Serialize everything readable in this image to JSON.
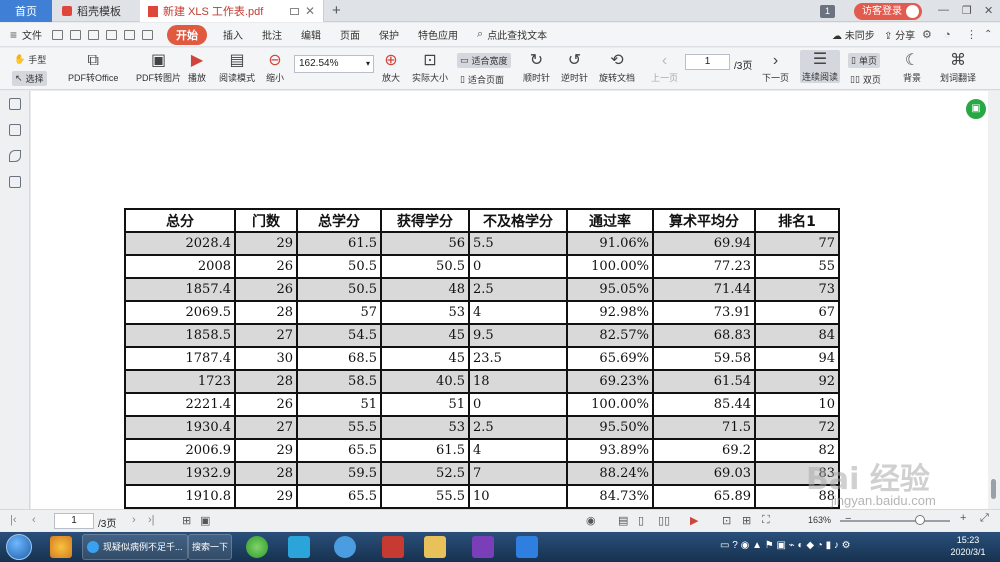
{
  "tabs": {
    "home": "首页",
    "templates": "稻壳模板",
    "document": "新建 XLS 工作表.pdf",
    "new_tab": "+",
    "page_count_badge": "1",
    "guest_login": "访客登录"
  },
  "menu": {
    "file": "文件",
    "items": [
      "开始",
      "插入",
      "批注",
      "编辑",
      "页面",
      "保护",
      "特色应用"
    ],
    "search": "点此查找文本",
    "sync": "未同步",
    "share": "分享"
  },
  "ribbon": {
    "hand": "手型",
    "select": "选择",
    "pdf_to_office": "PDF转Office",
    "pdf_to_image": "PDF转图片",
    "play": "播放",
    "read_mode": "阅读模式",
    "zoom_out": "缩小",
    "zoom_value": "162.54%",
    "zoom_in": "放大",
    "actual_size": "实际大小",
    "fit_width": "适合宽度",
    "fit_page": "适合页面",
    "rotate_cw": "顺时针",
    "rotate_ccw": "逆时针",
    "rotate_doc": "旋转文档",
    "prev_page": "上一页",
    "page_current": "1",
    "page_total": "/3页",
    "next_page": "下一页",
    "continuous": "连续阅读",
    "single": "单页",
    "double": "双页",
    "background": "背景",
    "translate": "划词翻译"
  },
  "table": {
    "headers": [
      "总分",
      "门数",
      "总学分",
      "获得学分",
      "不及格学分",
      "通过率",
      "算术平均分",
      "排名1"
    ],
    "rows": [
      [
        "2028.4",
        "29",
        "61.5",
        "56",
        "5.5",
        "91.06%",
        "69.94",
        "77"
      ],
      [
        "2008",
        "26",
        "50.5",
        "50.5",
        "0",
        "100.00%",
        "77.23",
        "55"
      ],
      [
        "1857.4",
        "26",
        "50.5",
        "48",
        "2.5",
        "95.05%",
        "71.44",
        "73"
      ],
      [
        "2069.5",
        "28",
        "57",
        "53",
        "4",
        "92.98%",
        "73.91",
        "67"
      ],
      [
        "1858.5",
        "27",
        "54.5",
        "45",
        "9.5",
        "82.57%",
        "68.83",
        "84"
      ],
      [
        "1787.4",
        "30",
        "68.5",
        "45",
        "23.5",
        "65.69%",
        "59.58",
        "94"
      ],
      [
        "1723",
        "28",
        "58.5",
        "40.5",
        "18",
        "69.23%",
        "61.54",
        "92"
      ],
      [
        "2221.4",
        "26",
        "51",
        "51",
        "0",
        "100.00%",
        "85.44",
        "10"
      ],
      [
        "1930.4",
        "27",
        "55.5",
        "53",
        "2.5",
        "95.50%",
        "71.5",
        "72"
      ],
      [
        "2006.9",
        "29",
        "65.5",
        "61.5",
        "4",
        "93.89%",
        "69.2",
        "82"
      ],
      [
        "1932.9",
        "28",
        "59.5",
        "52.5",
        "7",
        "88.24%",
        "69.03",
        "83"
      ],
      [
        "1910.8",
        "29",
        "65.5",
        "55.5",
        "10",
        "84.73%",
        "65.89",
        "88"
      ]
    ]
  },
  "watermark": {
    "logo": "Bai 经验",
    "url": "jingyan.baidu.com"
  },
  "statusbar": {
    "page_current": "1",
    "page_total": "/3页",
    "zoom": "163%"
  },
  "taskbar": {
    "ie_title": "现疑似病例不足千...",
    "search": "搜索一下",
    "clock_time": "15:23",
    "clock_date": "2020/3/1"
  }
}
